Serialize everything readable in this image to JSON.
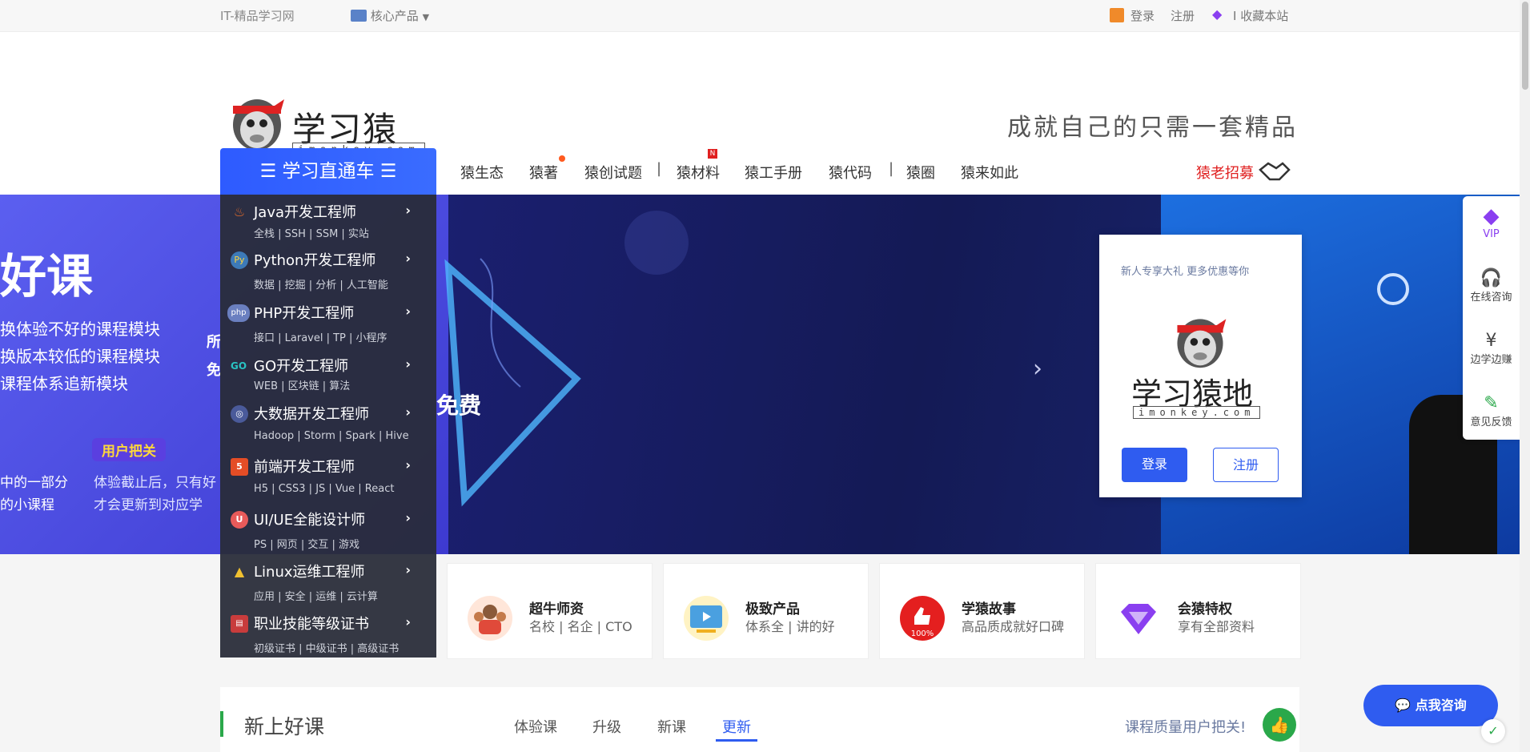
{
  "topbar": {
    "site_name": "IT-精品学习网",
    "core_products": "核心产品",
    "login": "登录",
    "register": "注册",
    "bookmark": "I 收藏本站"
  },
  "header": {
    "logo_text": "学习猿地",
    "logo_sub": "imonkey.com",
    "slogan": "成就自己的只需一套精品"
  },
  "nav": {
    "menu_button": "☰ 学习直通车 ☰",
    "items": [
      "猿生态",
      "猿著",
      "猿创试题",
      "猿材料",
      "猿工手册",
      "猿代码",
      "猿圈",
      "猿来如此"
    ],
    "recruit": "猿老招募"
  },
  "menu": [
    {
      "title": "Java开发工程师",
      "sub": "全栈 | SSH | SSM | 实站",
      "icon": "java-icon"
    },
    {
      "title": "Python开发工程师",
      "sub": "数据 | 挖掘 | 分析 | 人工智能",
      "icon": "python-icon"
    },
    {
      "title": "PHP开发工程师",
      "sub": "接口 | Laravel | TP | 小程序",
      "icon": "php-icon"
    },
    {
      "title": "GO开发工程师",
      "sub": "WEB | 区块链 | 算法",
      "icon": "go-icon"
    },
    {
      "title": "大数据开发工程师",
      "sub": "Hadoop | Storm | Spark | Hive",
      "icon": "bigdata-icon"
    },
    {
      "title": "前端开发工程师",
      "sub": "H5 | CSS3 | JS | Vue | React",
      "icon": "html5-icon"
    },
    {
      "title": "UI/UE全能设计师",
      "sub": "PS | 网页 | 交互 | 游戏",
      "icon": "ui-icon"
    },
    {
      "title": "Linux运维工程师",
      "sub": "应用 | 安全 | 运维 | 云计算",
      "icon": "linux-icon"
    },
    {
      "title": "职业技能等级证书",
      "sub": "初级证书 | 中级证书 | 高级证书",
      "icon": "certificate-icon"
    }
  ],
  "banner": {
    "big_title": "好课",
    "line1": "换体验不好的课程模块",
    "line2": "换版本较低的课程模块",
    "line3": "课程体系追新模块",
    "side_a": "所",
    "side_b": "免",
    "free_text": "免费",
    "tag": "用户把关",
    "left_a": "中的一部分",
    "left_b": "的小课程",
    "mid_a": "体验截止后，只有好",
    "mid_b": "才会更新到对应学"
  },
  "login_card": {
    "promo": "新人专享大礼  更多优惠等你",
    "logo_text": "学习猿地",
    "logo_sub": "imonkey.com",
    "login_button": "登录",
    "register_button": "注册"
  },
  "features": [
    {
      "title": "超牛师资",
      "sub": "名校 | 名企 | CTO"
    },
    {
      "title": "极致产品",
      "sub": "体系全 | 讲的好"
    },
    {
      "title": "学猿故事",
      "sub": "高品质成就好口碑"
    },
    {
      "title": "会猿特权",
      "sub": "享有全部资料"
    }
  ],
  "bottom": {
    "section_title": "新上好课",
    "tabs": [
      "体验课",
      "升级",
      "新课",
      "更新"
    ],
    "active_tab": 3,
    "slogan": "课程质量用户把关!"
  },
  "side_bar": {
    "vip": "VIP",
    "consult": "在线咨询",
    "earn": "边学边赚",
    "feedback": "意见反馈"
  },
  "consult_button": "点我咨询",
  "colors": {
    "primary": "#2f5cf0",
    "recruit_red": "#e02020",
    "vip_purple": "#8a3ff0",
    "menu_bg": "#282c38"
  }
}
